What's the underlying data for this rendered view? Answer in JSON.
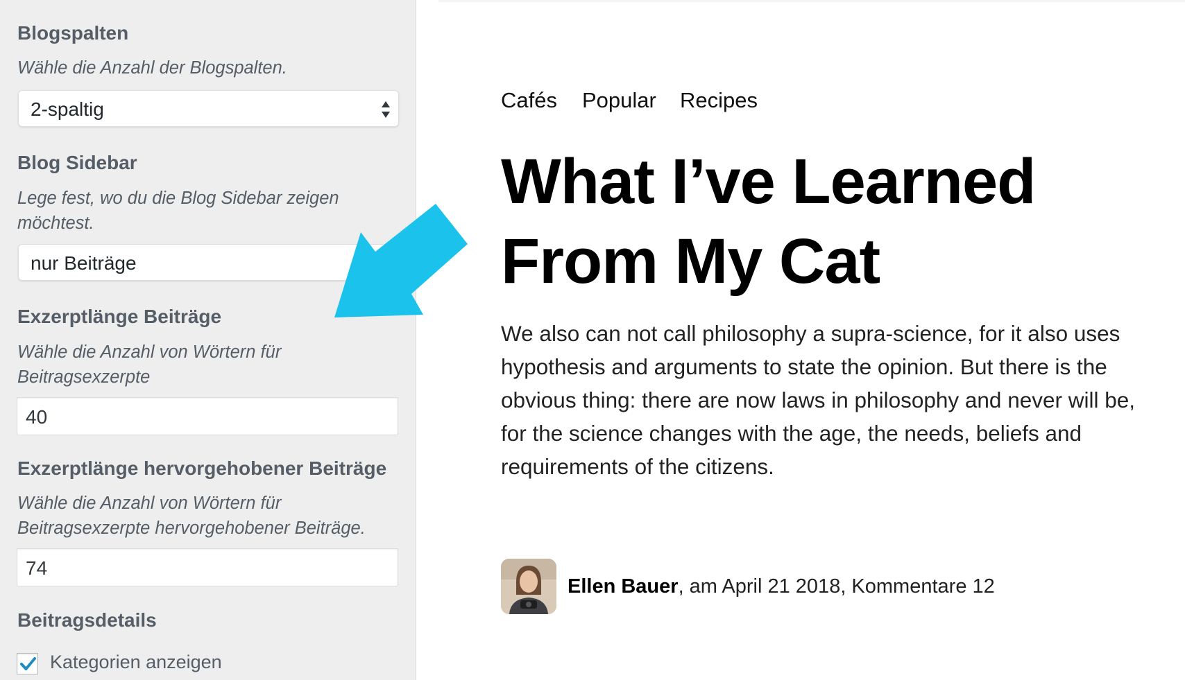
{
  "customizer": {
    "blog_columns": {
      "title": "Blogspalten",
      "description": "Wähle die Anzahl der Blogspalten.",
      "selected": "2-spaltig"
    },
    "blog_sidebar": {
      "title": "Blog Sidebar",
      "description_line1": "Lege fest, wo du die Blog Sidebar zeigen",
      "description_line2": "möchtest.",
      "selected": "nur Beiträge"
    },
    "excerpt_length": {
      "title": "Exzerptlänge Beiträge",
      "description_line1": "Wähle die Anzahl von Wörtern für",
      "description_line2": "Beitragsexzerpte",
      "value": "40"
    },
    "featured_excerpt_length": {
      "title": "Exzerptlänge hervorgehobener Beiträge",
      "description_line1": "Wähle die Anzahl von Wörtern für",
      "description_line2": "Beitragsexzerpte hervorgehobener Beiträge.",
      "value": "74"
    },
    "post_details": {
      "title": "Beitragsdetails",
      "show_categories_label": "Kategorien anzeigen",
      "show_categories_checked": true
    }
  },
  "preview": {
    "nav": [
      "Cafés",
      "Popular",
      "Recipes"
    ],
    "title_line1": "What I’ve Learned",
    "title_line2": "From My Cat",
    "excerpt_lines": [
      "We also can not call philosophy a supra-science, for it also uses",
      "hypothesis and arguments to state the opinion. But there is the",
      "obvious thing: there are now laws in philosophy and never will be,",
      "for the science changes with the age, the needs, beliefs and",
      "requirements of the citizens."
    ],
    "author": "Ellen Bauer",
    "meta": ", am April 21 2018, Kommentare 12"
  },
  "colors": {
    "panel_bg": "#eeeeee",
    "arrow": "#1bc3ec",
    "checkmark": "#1e8cbe"
  },
  "icons": [
    "select-arrows-icon",
    "checkmark-icon",
    "pointer-arrow-icon",
    "author-avatar"
  ]
}
